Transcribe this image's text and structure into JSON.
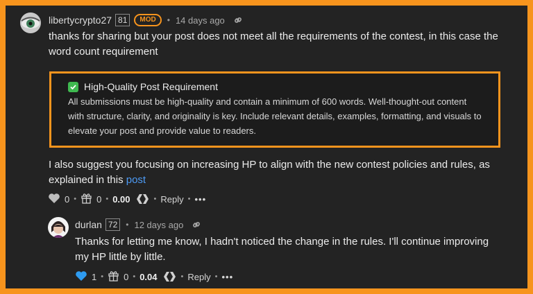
{
  "comment": {
    "author": "libertycrypto27",
    "reputation": "81",
    "badge": "MOD",
    "time": "14 days ago",
    "paragraph1": "thanks for sharing but your post does not meet all the requirements of the contest, in this case the word count requirement",
    "callout_title": "High-Quality Post Requirement",
    "callout_body": "All submissions must be high-quality and contain a minimum of 600 words. Well-thought-out content with structure, clarity, and originality is key. Include relevant details, examples, formatting, and visuals to elevate your post and provide value to readers.",
    "paragraph2": "I also suggest you focusing on increasing HP to align with the new contest policies and rules, as explained in this ",
    "paragraph2_link": "post",
    "likes": "0",
    "gifts": "0",
    "payout": "0.00",
    "reply_label": "Reply",
    "more_label": "•••"
  },
  "reply": {
    "author": "durlan",
    "reputation": "72",
    "time": "12 days ago",
    "text": "Thanks for letting me know, I hadn't noticed the change in the rules. I'll continue improving my HP little by little.",
    "likes": "1",
    "gifts": "0",
    "payout": "0.04",
    "reply_label": "Reply",
    "more_label": "•••"
  },
  "colors": {
    "frame_border": "#f7941d",
    "background": "#232323",
    "link": "#4d9bf5",
    "liked_heart": "#2e9bf0",
    "check": "#3fb950"
  },
  "icons": [
    "heart-icon",
    "gift-icon",
    "hive-icon",
    "link-icon",
    "check-icon"
  ]
}
